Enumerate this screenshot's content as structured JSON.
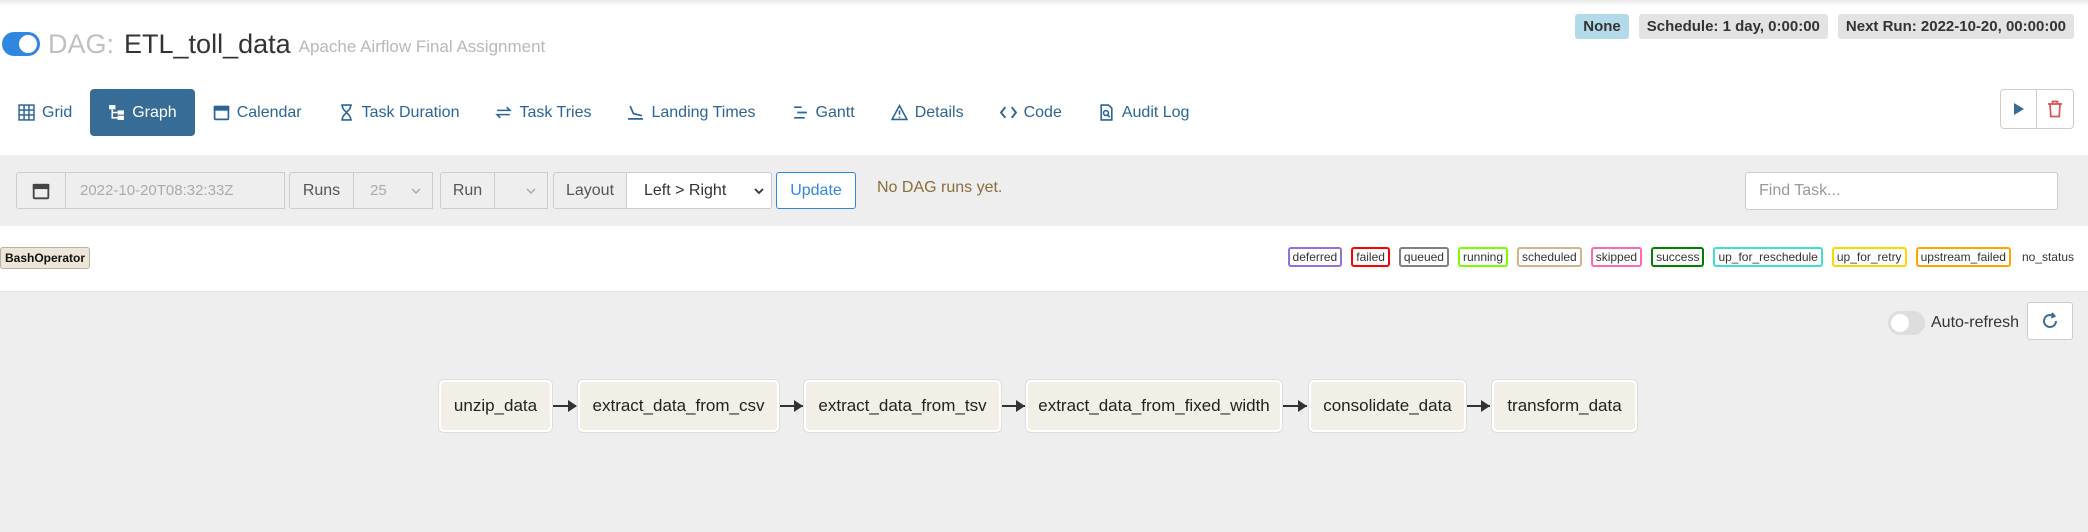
{
  "dag": {
    "prefix": "DAG:",
    "id": "ETL_toll_data",
    "description": "Apache Airflow Final Assignment",
    "paused": false
  },
  "badges": {
    "state": "None",
    "schedule": "Schedule: 1 day, 0:00:00",
    "next_run": "Next Run: 2022-10-20, 00:00:00"
  },
  "tabs": [
    {
      "label": "Grid",
      "icon": "grid-icon",
      "active": false
    },
    {
      "label": "Graph",
      "icon": "graph-icon",
      "active": true
    },
    {
      "label": "Calendar",
      "icon": "calendar-icon",
      "active": false
    },
    {
      "label": "Task Duration",
      "icon": "hourglass-icon",
      "active": false
    },
    {
      "label": "Task Tries",
      "icon": "retry-icon",
      "active": false
    },
    {
      "label": "Landing Times",
      "icon": "landing-icon",
      "active": false
    },
    {
      "label": "Gantt",
      "icon": "gantt-icon",
      "active": false
    },
    {
      "label": "Details",
      "icon": "warning-icon",
      "active": false
    },
    {
      "label": "Code",
      "icon": "code-icon",
      "active": false
    },
    {
      "label": "Audit Log",
      "icon": "audit-icon",
      "active": false
    }
  ],
  "toolbar": {
    "base_date": "2022-10-20T08:32:33Z",
    "runs_label": "Runs",
    "runs_value": "25",
    "run_label": "Run",
    "run_value": "",
    "layout_label": "Layout",
    "layout_value": "Left > Right",
    "update_label": "Update",
    "status_message": "No DAG runs yet.",
    "find_task_placeholder": "Find Task..."
  },
  "legend": {
    "operator": "BashOperator",
    "states": [
      {
        "label": "deferred",
        "color": "#9370db"
      },
      {
        "label": "failed",
        "color": "#ff0000"
      },
      {
        "label": "queued",
        "color": "#808080"
      },
      {
        "label": "running",
        "color": "#7cfc00"
      },
      {
        "label": "scheduled",
        "color": "#d2b48c"
      },
      {
        "label": "skipped",
        "color": "#ff69b4"
      },
      {
        "label": "success",
        "color": "#008000"
      },
      {
        "label": "up_for_reschedule",
        "color": "#40e0d0"
      },
      {
        "label": "up_for_retry",
        "color": "#ffd700"
      },
      {
        "label": "upstream_failed",
        "color": "#ffa500"
      },
      {
        "label": "no_status",
        "color": ""
      }
    ]
  },
  "graph": {
    "auto_refresh_label": "Auto-refresh",
    "auto_refresh_on": false,
    "tasks": [
      "unzip_data",
      "extract_data_from_csv",
      "extract_data_from_tsv",
      "extract_data_from_fixed_width",
      "consolidate_data",
      "transform_data"
    ]
  },
  "colors": {
    "accent": "#2f87e0",
    "active_tab": "#376c96",
    "task_node": "#f2efe6",
    "status_message": "#8a6d3b"
  }
}
